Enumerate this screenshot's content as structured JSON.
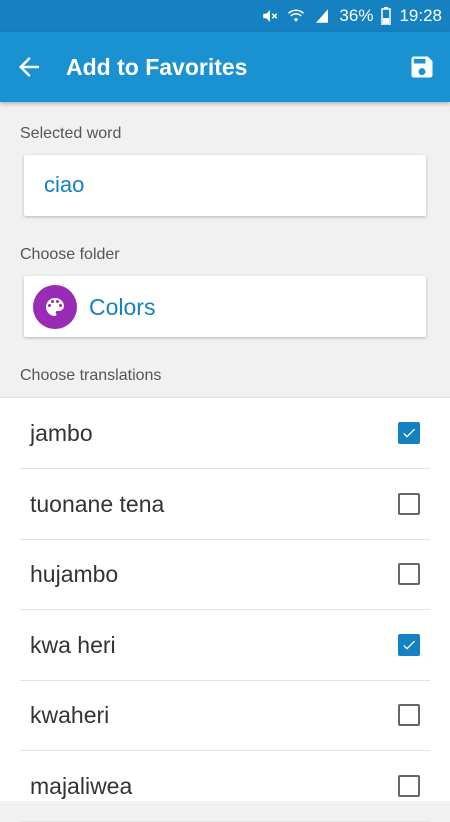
{
  "status_bar": {
    "battery_percent": "36%",
    "time": "19:28",
    "icons": [
      "mute-icon",
      "wifi-icon",
      "signal-icon",
      "battery-icon"
    ]
  },
  "toolbar": {
    "title": "Add to Favorites",
    "back_icon": "arrow-back-icon",
    "save_icon": "save-icon",
    "color": "#1a91d1"
  },
  "selected_word": {
    "label": "Selected word",
    "value": "ciao"
  },
  "folder": {
    "label": "Choose folder",
    "name": "Colors",
    "icon": "palette-icon",
    "icon_color": "#9a2bb5"
  },
  "translations": {
    "label": "Choose translations",
    "items": [
      {
        "text": "jambo",
        "checked": true
      },
      {
        "text": "tuonane tena",
        "checked": false
      },
      {
        "text": "hujambo",
        "checked": false
      },
      {
        "text": "kwa heri",
        "checked": true
      },
      {
        "text": "kwaheri",
        "checked": false
      },
      {
        "text": "majaliwea",
        "checked": false
      }
    ]
  }
}
